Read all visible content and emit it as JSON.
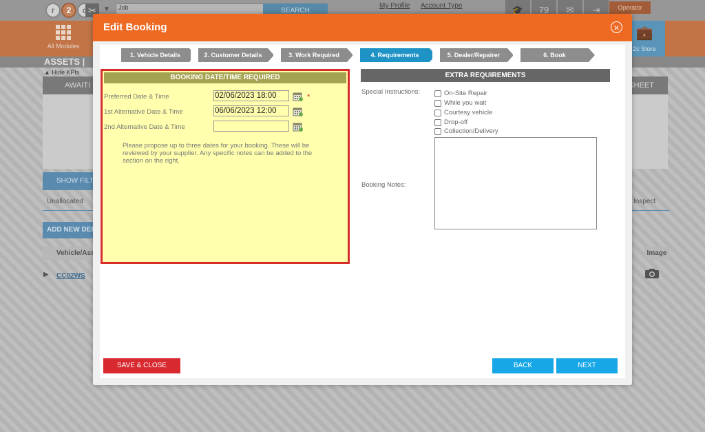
{
  "background": {
    "logo": [
      "r",
      "2",
      "c"
    ],
    "job_input_value": "Job",
    "search_label": "SEARCH",
    "my_profile": "My Profile",
    "account_type": "Account Type",
    "badge_count": "79",
    "operator_label": "Operator",
    "all_modules": "All Modules",
    "store_label": "2c Store",
    "assets_title": "ASSETS  |",
    "hide_kpis": "▲ Hide KPIs",
    "awaiting": "AWAITI",
    "sheet": "SHEET",
    "show_filters": "SHOW FILT",
    "unallocated": "Unallocated",
    "inspect": "Inspect",
    "add_new": "ADD NEW DEF",
    "vehicle_col": "Vehicle/Ass",
    "image_col": "Image",
    "row_reg": "CC02WS"
  },
  "modal": {
    "title": "Edit Booking",
    "close_icon": "close-icon",
    "steps": [
      {
        "label": "1. Vehicle Details",
        "active": false
      },
      {
        "label": "2. Customer Details",
        "active": false
      },
      {
        "label": "3. Work Required",
        "active": false
      },
      {
        "label": "4. Requirements",
        "active": true
      },
      {
        "label": "5. Dealer/Repairer",
        "active": false
      },
      {
        "label": "6. Book",
        "active": false
      }
    ],
    "booking": {
      "header": "BOOKING DATE/TIME REQUIRED",
      "preferred_label": "Preferred Date & Time",
      "preferred_value": "02/06/2023 18:00",
      "alt1_label": "1st Alternative Date & Time",
      "alt1_value": "06/06/2023 12:00",
      "alt2_label": "2nd Alternative Date & Time",
      "alt2_value": "",
      "required_marker": "*",
      "note": "Please propose up to three dates for your booking. These will be reviewed by your supplier. Any specific notes can be added to the section on the right."
    },
    "extra": {
      "header": "EXTRA REQUIREMENTS",
      "special_label": "Special Instructions:",
      "options": [
        "On-Site Repair",
        "While you wait",
        "Courtesy vehicle",
        "Drop-off",
        "Collection/Delivery"
      ],
      "notes_label": "Booking Notes:",
      "notes_value": ""
    },
    "buttons": {
      "save_close": "SAVE & CLOSE",
      "back": "BACK",
      "next": "NEXT"
    }
  },
  "colors": {
    "header_orange": "#ee6a23",
    "active_step": "#1f93c6",
    "panel_yellow": "#ffffae",
    "panel_border_red": "#d72d2a",
    "save_red": "#d92930",
    "nav_blue": "#18a7e6"
  }
}
